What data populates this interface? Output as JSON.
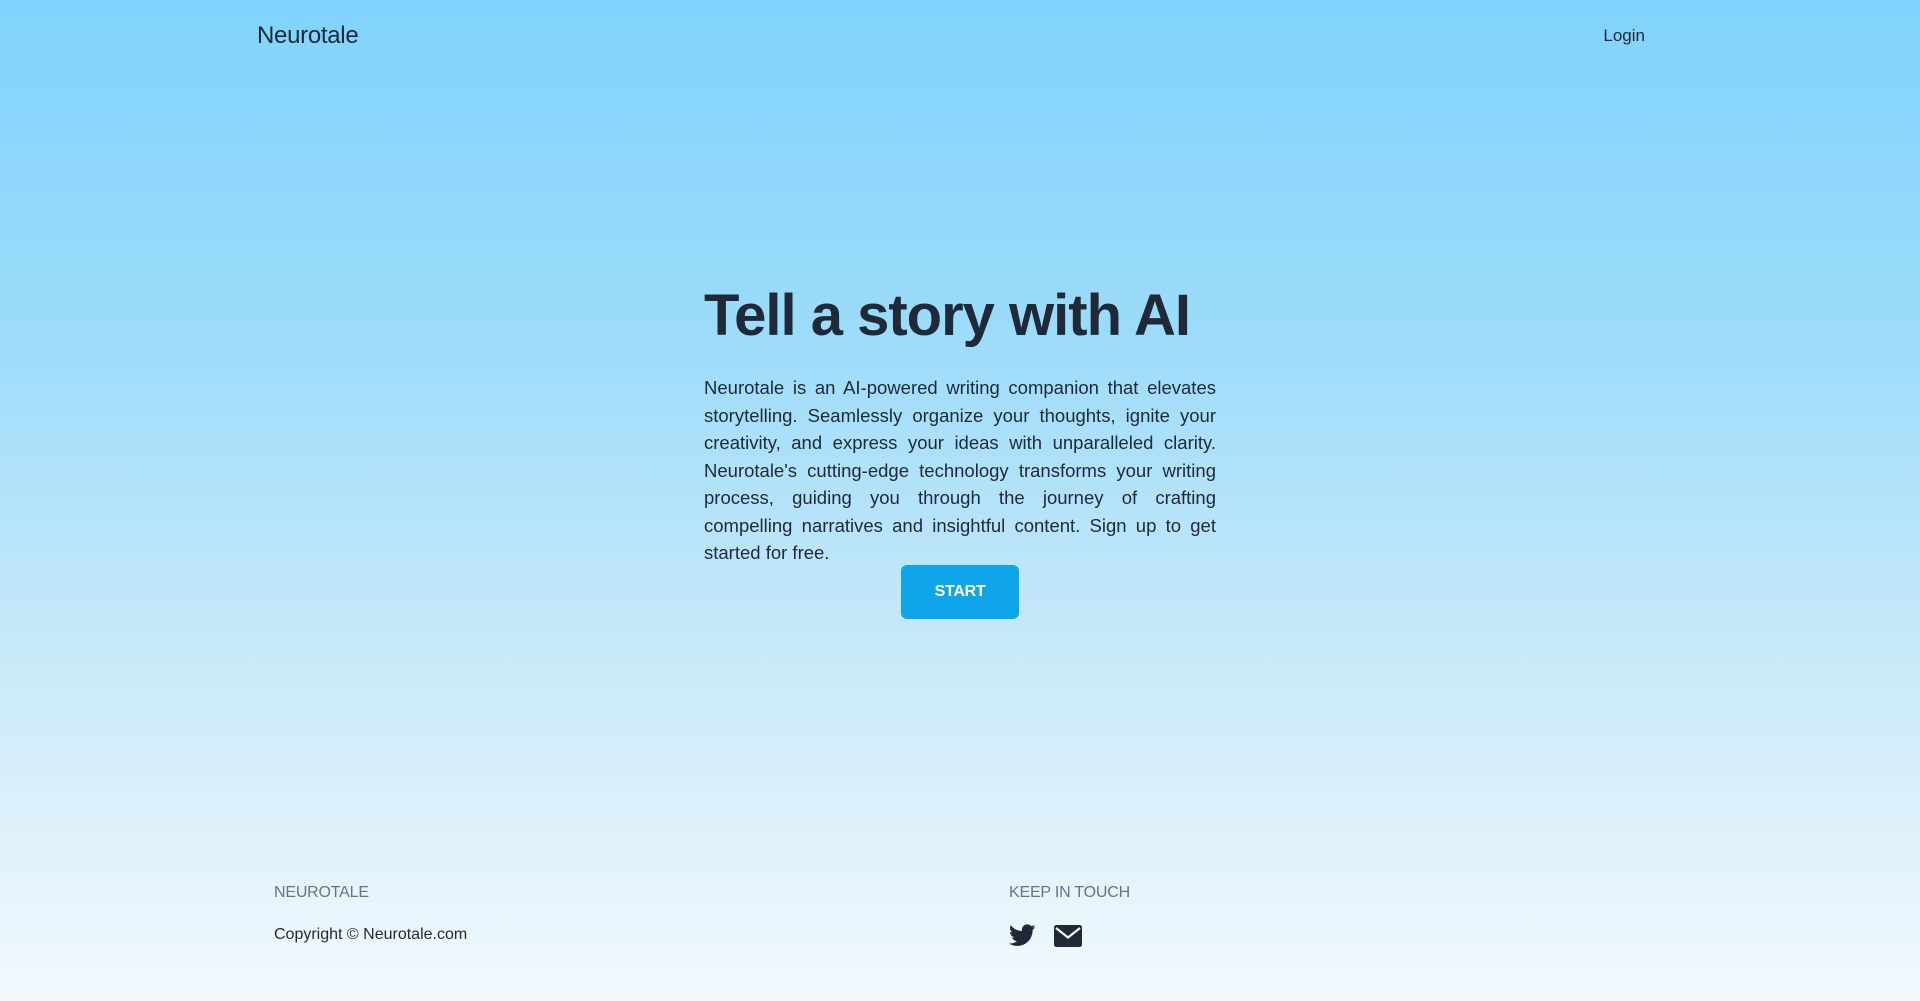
{
  "header": {
    "brand": "Neurotale",
    "login_label": "Login"
  },
  "hero": {
    "title": "Tell a story with AI",
    "description": "Neurotale is an AI-powered writing companion that elevates storytelling. Seamlessly organize your thoughts, ignite your creativity, and express your ideas with unparalleled clarity. Neurotale's cutting-edge technology transforms your writing process, guiding you through the journey of crafting compelling narratives and insightful content. Sign up to get started for free.",
    "start_label": "START"
  },
  "footer": {
    "brand_heading": "NEUROTALE",
    "copyright": "Copyright © Neurotale.com",
    "contact_heading": "KEEP IN TOUCH",
    "icons": [
      "twitter-icon",
      "email-icon"
    ]
  },
  "colors": {
    "accent": "#0ea5e9",
    "text": "#1f2937",
    "muted": "#6b7280"
  }
}
